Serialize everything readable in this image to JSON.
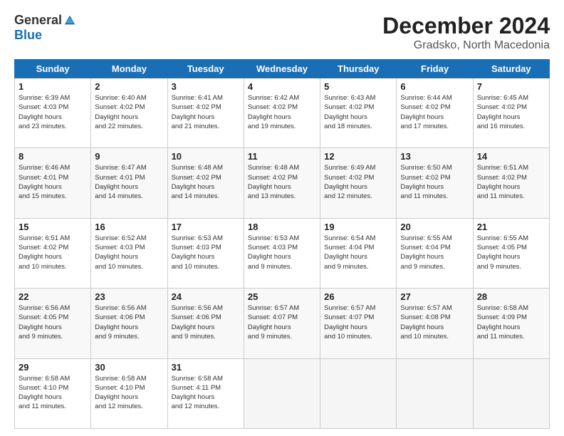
{
  "header": {
    "logo_general": "General",
    "logo_blue": "Blue",
    "month_title": "December 2024",
    "location": "Gradsko, North Macedonia"
  },
  "days_of_week": [
    "Sunday",
    "Monday",
    "Tuesday",
    "Wednesday",
    "Thursday",
    "Friday",
    "Saturday"
  ],
  "weeks": [
    [
      {
        "day": "1",
        "sunrise": "6:39 AM",
        "sunset": "4:03 PM",
        "daylight": "9 hours and 23 minutes."
      },
      {
        "day": "2",
        "sunrise": "6:40 AM",
        "sunset": "4:02 PM",
        "daylight": "9 hours and 22 minutes."
      },
      {
        "day": "3",
        "sunrise": "6:41 AM",
        "sunset": "4:02 PM",
        "daylight": "9 hours and 21 minutes."
      },
      {
        "day": "4",
        "sunrise": "6:42 AM",
        "sunset": "4:02 PM",
        "daylight": "9 hours and 19 minutes."
      },
      {
        "day": "5",
        "sunrise": "6:43 AM",
        "sunset": "4:02 PM",
        "daylight": "9 hours and 18 minutes."
      },
      {
        "day": "6",
        "sunrise": "6:44 AM",
        "sunset": "4:02 PM",
        "daylight": "9 hours and 17 minutes."
      },
      {
        "day": "7",
        "sunrise": "6:45 AM",
        "sunset": "4:02 PM",
        "daylight": "9 hours and 16 minutes."
      }
    ],
    [
      {
        "day": "8",
        "sunrise": "6:46 AM",
        "sunset": "4:01 PM",
        "daylight": "9 hours and 15 minutes."
      },
      {
        "day": "9",
        "sunrise": "6:47 AM",
        "sunset": "4:01 PM",
        "daylight": "9 hours and 14 minutes."
      },
      {
        "day": "10",
        "sunrise": "6:48 AM",
        "sunset": "4:02 PM",
        "daylight": "9 hours and 14 minutes."
      },
      {
        "day": "11",
        "sunrise": "6:48 AM",
        "sunset": "4:02 PM",
        "daylight": "9 hours and 13 minutes."
      },
      {
        "day": "12",
        "sunrise": "6:49 AM",
        "sunset": "4:02 PM",
        "daylight": "9 hours and 12 minutes."
      },
      {
        "day": "13",
        "sunrise": "6:50 AM",
        "sunset": "4:02 PM",
        "daylight": "9 hours and 11 minutes."
      },
      {
        "day": "14",
        "sunrise": "6:51 AM",
        "sunset": "4:02 PM",
        "daylight": "9 hours and 11 minutes."
      }
    ],
    [
      {
        "day": "15",
        "sunrise": "6:51 AM",
        "sunset": "4:02 PM",
        "daylight": "9 hours and 10 minutes."
      },
      {
        "day": "16",
        "sunrise": "6:52 AM",
        "sunset": "4:03 PM",
        "daylight": "9 hours and 10 minutes."
      },
      {
        "day": "17",
        "sunrise": "6:53 AM",
        "sunset": "4:03 PM",
        "daylight": "9 hours and 10 minutes."
      },
      {
        "day": "18",
        "sunrise": "6:53 AM",
        "sunset": "4:03 PM",
        "daylight": "9 hours and 9 minutes."
      },
      {
        "day": "19",
        "sunrise": "6:54 AM",
        "sunset": "4:04 PM",
        "daylight": "9 hours and 9 minutes."
      },
      {
        "day": "20",
        "sunrise": "6:55 AM",
        "sunset": "4:04 PM",
        "daylight": "9 hours and 9 minutes."
      },
      {
        "day": "21",
        "sunrise": "6:55 AM",
        "sunset": "4:05 PM",
        "daylight": "9 hours and 9 minutes."
      }
    ],
    [
      {
        "day": "22",
        "sunrise": "6:56 AM",
        "sunset": "4:05 PM",
        "daylight": "9 hours and 9 minutes."
      },
      {
        "day": "23",
        "sunrise": "6:56 AM",
        "sunset": "4:06 PM",
        "daylight": "9 hours and 9 minutes."
      },
      {
        "day": "24",
        "sunrise": "6:56 AM",
        "sunset": "4:06 PM",
        "daylight": "9 hours and 9 minutes."
      },
      {
        "day": "25",
        "sunrise": "6:57 AM",
        "sunset": "4:07 PM",
        "daylight": "9 hours and 9 minutes."
      },
      {
        "day": "26",
        "sunrise": "6:57 AM",
        "sunset": "4:07 PM",
        "daylight": "9 hours and 10 minutes."
      },
      {
        "day": "27",
        "sunrise": "6:57 AM",
        "sunset": "4:08 PM",
        "daylight": "9 hours and 10 minutes."
      },
      {
        "day": "28",
        "sunrise": "6:58 AM",
        "sunset": "4:09 PM",
        "daylight": "9 hours and 11 minutes."
      }
    ],
    [
      {
        "day": "29",
        "sunrise": "6:58 AM",
        "sunset": "4:10 PM",
        "daylight": "9 hours and 11 minutes."
      },
      {
        "day": "30",
        "sunrise": "6:58 AM",
        "sunset": "4:10 PM",
        "daylight": "9 hours and 12 minutes."
      },
      {
        "day": "31",
        "sunrise": "6:58 AM",
        "sunset": "4:11 PM",
        "daylight": "9 hours and 12 minutes."
      },
      null,
      null,
      null,
      null
    ]
  ]
}
